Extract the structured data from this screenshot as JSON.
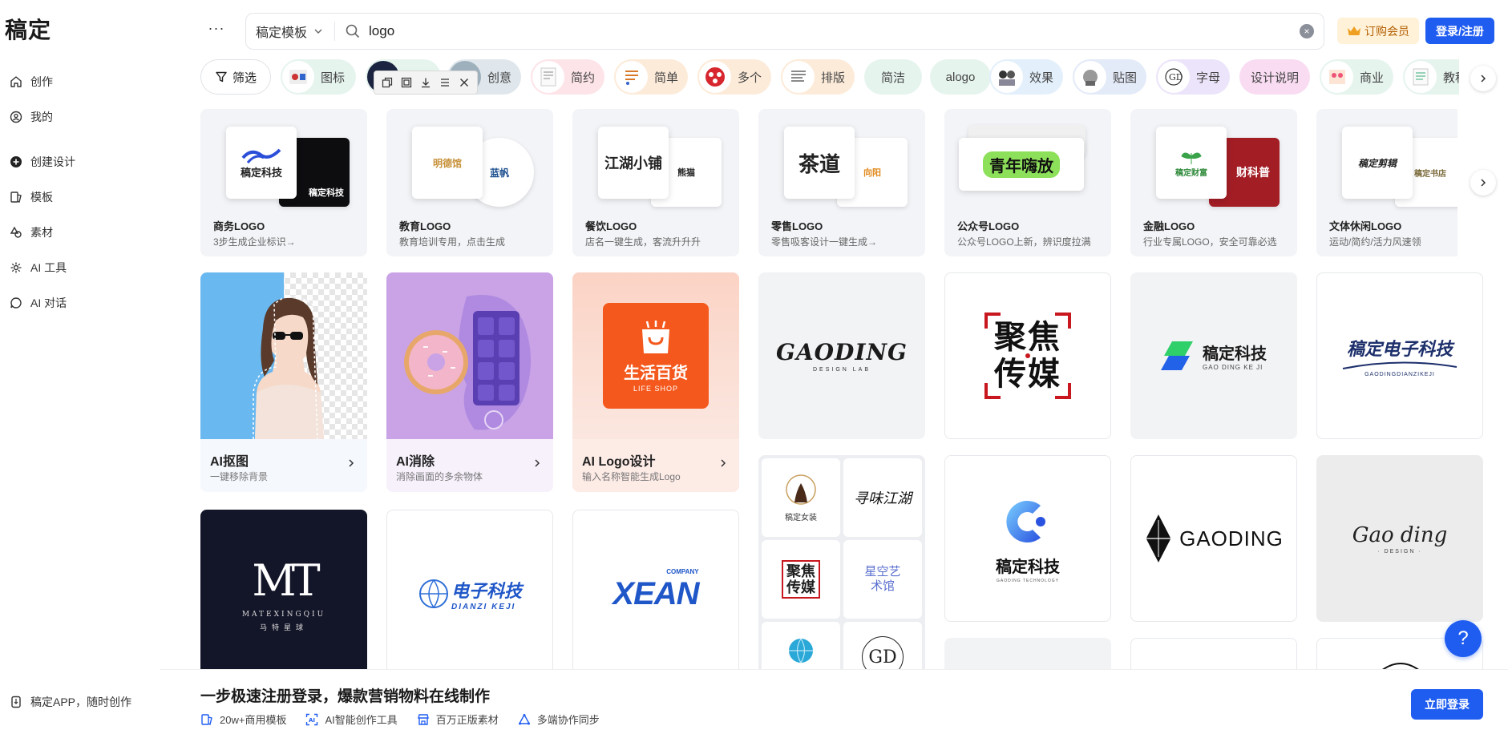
{
  "brand": "稿定",
  "sidebar": {
    "items": [
      {
        "label": "创作",
        "icon": "home-icon"
      },
      {
        "label": "我的",
        "icon": "user-icon"
      },
      {
        "label": "创建设计",
        "icon": "plus-circle-icon"
      },
      {
        "label": "模板",
        "icon": "template-icon"
      },
      {
        "label": "素材",
        "icon": "shapes-icon"
      },
      {
        "label": "AI 工具",
        "icon": "sparkle-icon"
      },
      {
        "label": "AI 对话",
        "icon": "chat-icon"
      }
    ],
    "app_link": "稿定APP，随时创作"
  },
  "header": {
    "more": "···",
    "search_scope": "稿定模板",
    "search_value": "logo",
    "clear": "×",
    "vip_label": "订购会员",
    "login_label": "登录/注册"
  },
  "tags": {
    "filter_label": "筛选",
    "items": [
      "图标",
      "",
      "创意",
      "简约",
      "简单",
      "多个",
      "排版",
      "简洁",
      "alogo",
      "效果",
      "贴图",
      "字母",
      "设计说明",
      "商业",
      "教程"
    ]
  },
  "categories": [
    {
      "title": "商务LOGO",
      "subtitle": "3步生成企业标识→",
      "front": "稿定科技",
      "back": "稿定科技"
    },
    {
      "title": "教育LOGO",
      "subtitle": "教育培训专用，点击生成",
      "front": "明德馆",
      "back": "蓝帆"
    },
    {
      "title": "餐饮LOGO",
      "subtitle": "店名一键生成，客流升升升",
      "front": "江湖小铺",
      "back": "熊猫"
    },
    {
      "title": "零售LOGO",
      "subtitle": "零售吸客设计一键生成→",
      "front": "茶道",
      "back": "向阳"
    },
    {
      "title": "公众号LOGO",
      "subtitle": "公众号LOGO上新，辨识度拉满",
      "front": "青年嗨放",
      "back": ""
    },
    {
      "title": "金融LOGO",
      "subtitle": "行业专属LOGO，安全可靠必选",
      "front": "稿定财富",
      "back": "财科普"
    },
    {
      "title": "文体休闲LOGO",
      "subtitle": "运动/简约/活力风速领",
      "front": "稿定剪辑",
      "back": "稿定书店"
    }
  ],
  "ai_tools": [
    {
      "title": "AI抠图",
      "subtitle": "一键移除背景"
    },
    {
      "title": "AI消除",
      "subtitle": "消除画面的多余物体"
    },
    {
      "title": "AI Logo设计",
      "subtitle": "输入名称智能生成Logo"
    }
  ],
  "logos": {
    "life_shop_cn": "生活百货",
    "life_shop_en": "LIFE SHOP",
    "gaoding": "GAODING",
    "gaoding_sub": "DESIGN LAB",
    "jujiao_1": "聚焦",
    "jujiao_2": "传媒",
    "gdkj_cn": "稿定科技",
    "gdkj_en": "GAO DING KE JI",
    "dianzi_cn": "稿定电子科技",
    "dianzi_en": "GAODINGDIANZIKEJI",
    "mt_big": "MT",
    "mt_en": "MATEXINGQIU",
    "mt_cn": "马特星球",
    "dzkj_cn": "电子科技",
    "dzkj_en": "DIANZI KEJI",
    "xean": "XEAN",
    "xean_co": "COMPANY",
    "nvzhuang": "稿定女装",
    "xunwei": "寻味江湖",
    "xingkong": "星空艺术馆",
    "gd_letters": "GD",
    "c_logo_cn": "稿定科技",
    "c_logo_en": "GAODING TECHNOLOGY",
    "gaoding2": "GAODING",
    "script": "Gao ding",
    "script_sub": "· DESIGN ·"
  },
  "help": "?",
  "banner": {
    "title": "一步极速注册登录，爆款营销物料在线制作",
    "features": [
      "20w+商用模板",
      "AI智能创作工具",
      "百万正版素材",
      "多端协作同步"
    ],
    "button": "立即登录"
  },
  "colors": {
    "accent": "#1f5cf0",
    "vip_bg": "#fff2d9",
    "vip_text": "#b25d00"
  }
}
